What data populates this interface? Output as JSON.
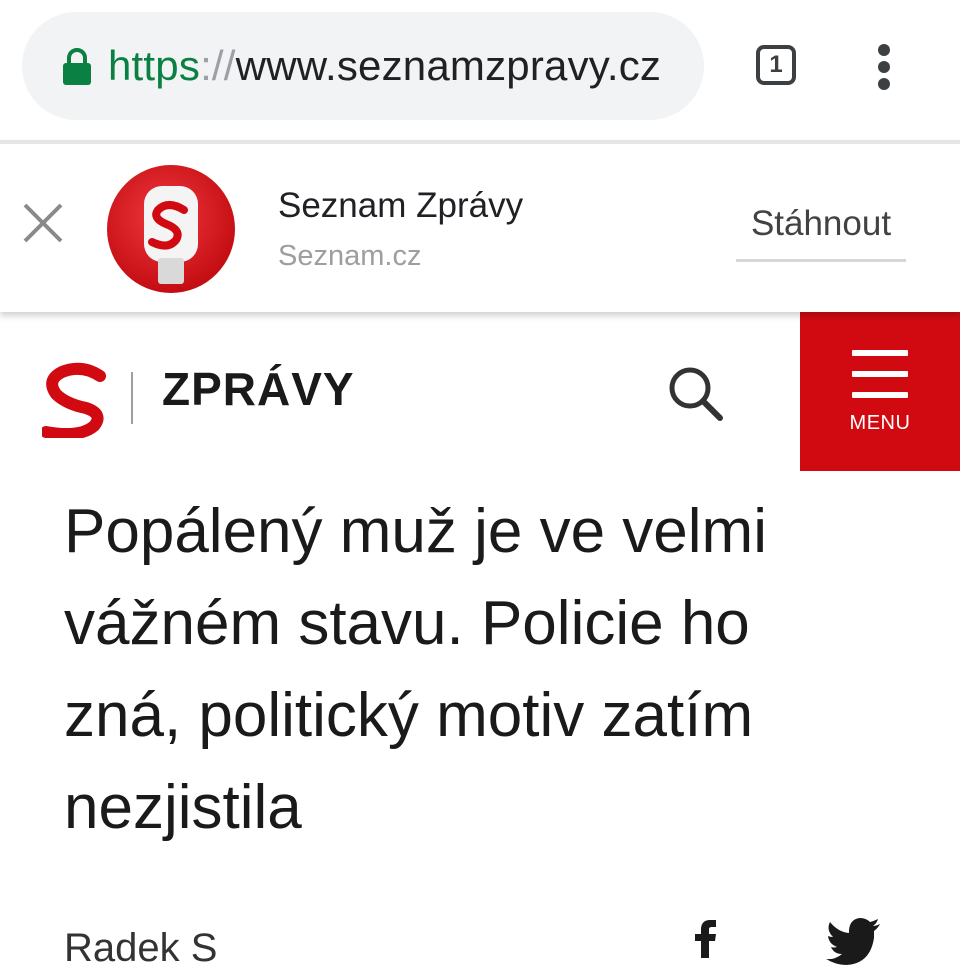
{
  "browser": {
    "url_scheme": "https",
    "url_separator": "://",
    "url_host": "www.seznamzpravy.cz",
    "tab_count": "1",
    "lock_color": "#0b8043"
  },
  "app_banner": {
    "app_name": "Seznam Zprávy",
    "app_host": "Seznam.cz",
    "install_label": "Stáhnout",
    "close_icon": "close-icon",
    "icon_color": "#d10a11"
  },
  "site_header": {
    "logo_letter": "S",
    "site_name": "ZPRÁVY",
    "search_icon": "search-icon",
    "menu_label": "MENU",
    "accent_color": "#d10a11"
  },
  "article": {
    "headline": "Popálený muž je ve velmi vážném stavu. Policie ho zná, politický motiv zatím nezjistila",
    "byline_partial": "Radek  S",
    "share_icons": [
      "facebook-icon",
      "twitter-icon"
    ]
  }
}
